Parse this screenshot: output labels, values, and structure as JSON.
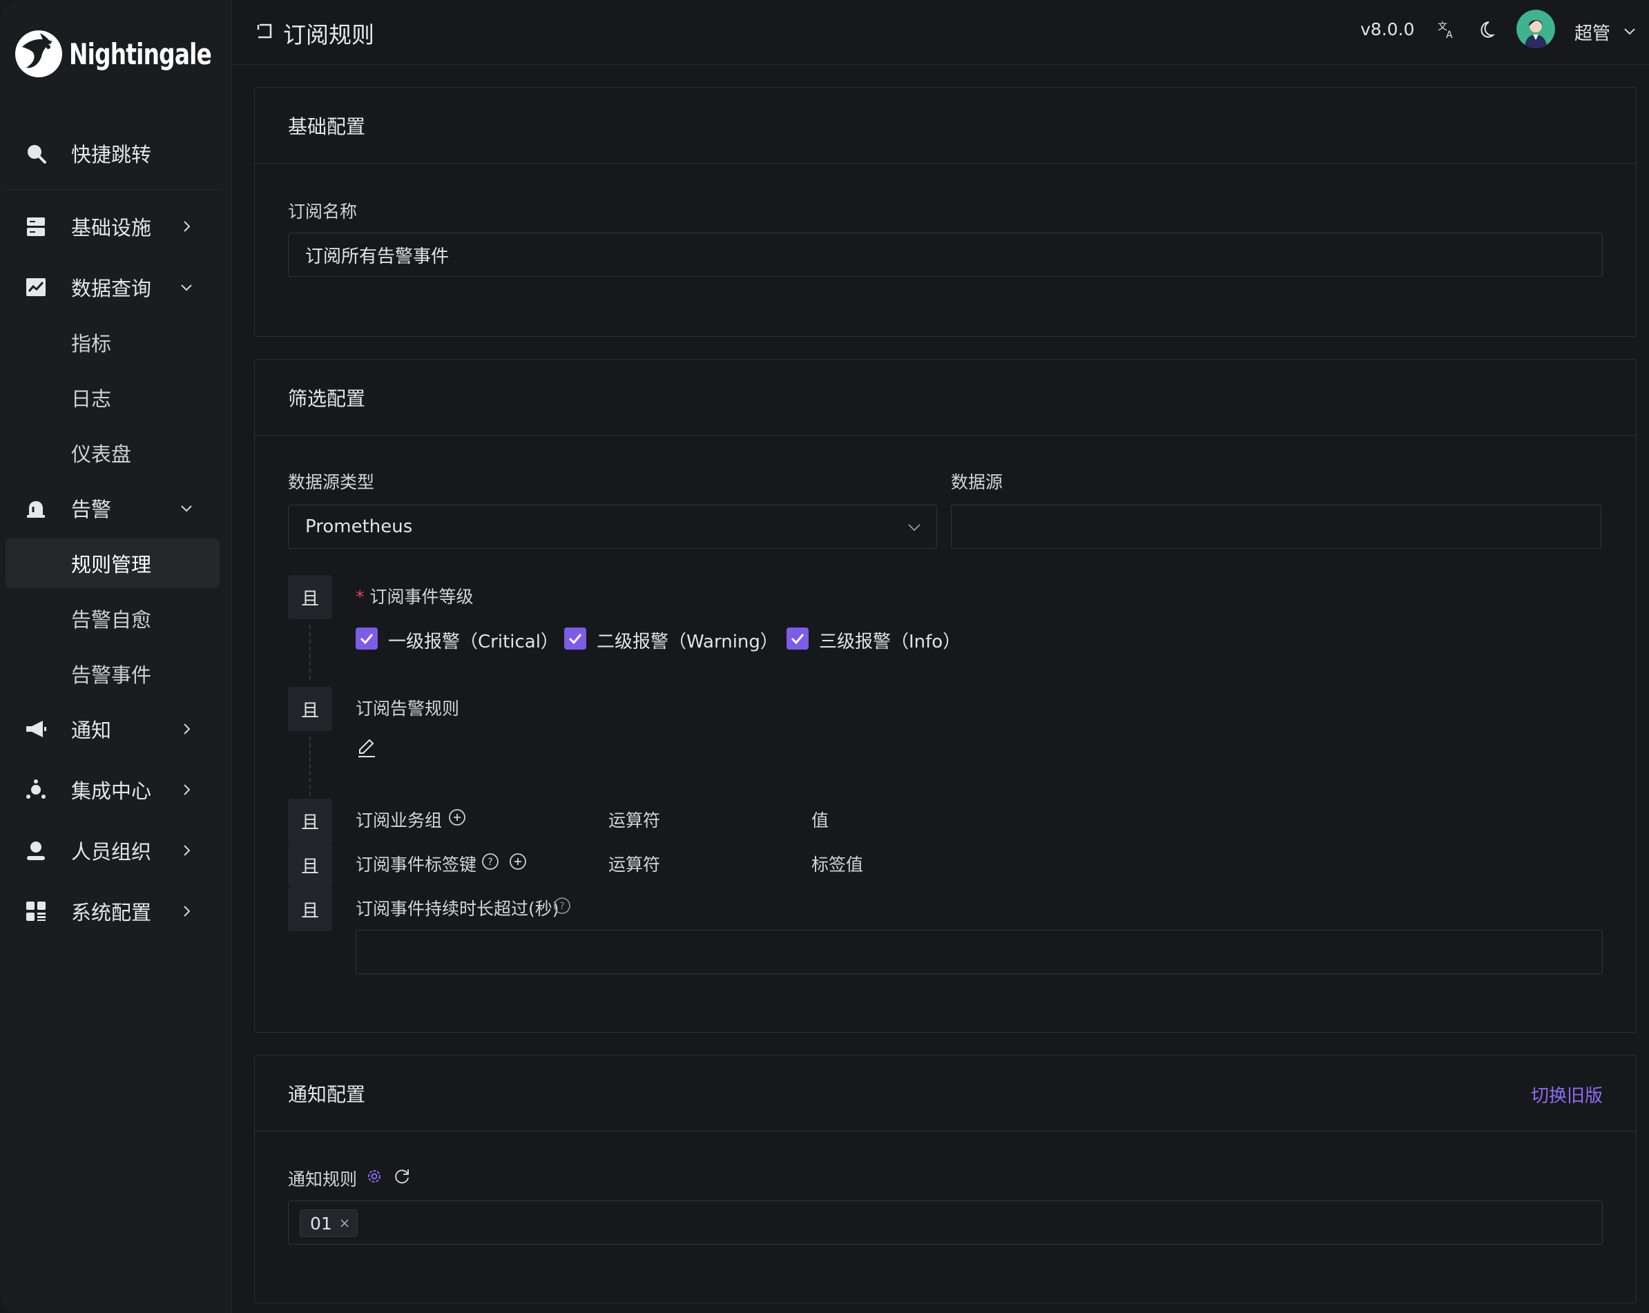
{
  "app": {
    "name": "Nightingale"
  },
  "sidebar": {
    "quick_jump": "快捷跳转",
    "items": [
      {
        "label": "基础设施"
      },
      {
        "label": "数据查询"
      },
      {
        "label": "告警"
      },
      {
        "label": "通知"
      },
      {
        "label": "集成中心"
      },
      {
        "label": "人员组织"
      },
      {
        "label": "系统配置"
      }
    ],
    "data_query_sub": [
      "指标",
      "日志",
      "仪表盘"
    ],
    "alert_sub": [
      "规则管理",
      "告警自愈",
      "告警事件"
    ],
    "active_item": "规则管理"
  },
  "header": {
    "title": "订阅规则",
    "version": "v8.0.0",
    "username": "超管"
  },
  "basic": {
    "title": "基础配置",
    "name_label": "订阅名称",
    "name_value": "订阅所有告警事件"
  },
  "filter": {
    "title": "筛选配置",
    "ds_type_label": "数据源类型",
    "ds_type_value": "Prometheus",
    "ds_label": "数据源",
    "ds_value": "",
    "and_label": "且",
    "level_label": "订阅事件等级",
    "levels": [
      {
        "label": "一级报警（Critical）",
        "checked": true
      },
      {
        "label": "二级报警（Warning）",
        "checked": true
      },
      {
        "label": "三级报警（Info）",
        "checked": true
      }
    ],
    "rule_label": "订阅告警规则",
    "group_label": "订阅业务组",
    "operator_label": "运算符",
    "value_label": "值",
    "tag_key_label": "订阅事件标签键",
    "tag_value_label": "标签值",
    "duration_label": "订阅事件持续时长超过(秒)",
    "duration_value": ""
  },
  "notify": {
    "title": "通知配置",
    "switch_label": "切换旧版",
    "rule_label": "通知规则",
    "selected_tags": [
      "01"
    ]
  },
  "colors": {
    "accent": "#7d5ce8",
    "link": "#8b6cf5",
    "background": "#17181b",
    "sidebar": "#1b1c1f"
  }
}
